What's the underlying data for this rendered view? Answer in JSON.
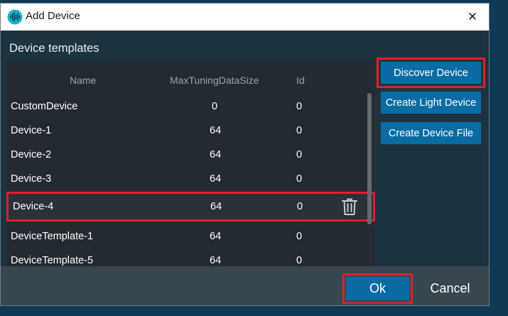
{
  "window": {
    "title": "Add Device",
    "close_glyph": "✕"
  },
  "section_title": "Device templates",
  "table": {
    "columns": [
      "Name",
      "MaxTuningDataSize",
      "Id"
    ],
    "rows": [
      {
        "name": "CustomDevice",
        "size": "0",
        "id": "0"
      },
      {
        "name": "Device-1",
        "size": "64",
        "id": "0"
      },
      {
        "name": "Device-2",
        "size": "64",
        "id": "0"
      },
      {
        "name": "Device-3",
        "size": "64",
        "id": "0"
      },
      {
        "name": "Device-4",
        "size": "64",
        "id": "0"
      },
      {
        "name": "DeviceTemplate-1",
        "size": "64",
        "id": "0"
      },
      {
        "name": "DeviceTemplate-5",
        "size": "64",
        "id": "0"
      }
    ]
  },
  "buttons": {
    "discover": "Discover Device",
    "create_light": "Create Light Device",
    "create_file": "Create Device File",
    "ok": "Ok",
    "cancel": "Cancel"
  },
  "colors": {
    "accent": "#0a6ca2",
    "highlight": "#e21d2a",
    "dialog_bg": "#1e3340",
    "table_bg": "#232a31",
    "footer_bg": "#384650"
  }
}
